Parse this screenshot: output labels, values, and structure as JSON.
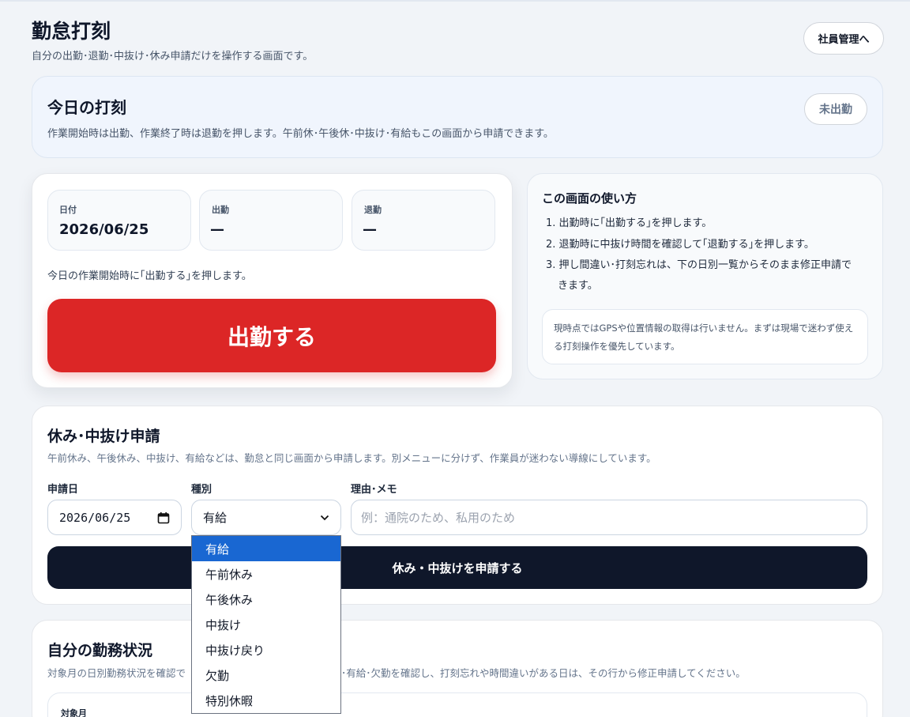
{
  "header": {
    "title": "勤怠打刻",
    "subtitle": "自分の出勤･退勤･中抜け･休み申請だけを操作する画面です。",
    "employee_admin_button": "社員管理へ"
  },
  "today": {
    "title": "今日の打刻",
    "description": "作業開始時は出勤、作業終了時は退勤を押します。午前休･午後休･中抜け･有給もこの画面から申請できます。",
    "status": "未出勤"
  },
  "punch": {
    "date_label": "日付",
    "date_value": "2026/06/25",
    "clock_in_label": "出勤",
    "clock_in_value": "—",
    "clock_out_label": "退勤",
    "clock_out_value": "—",
    "note": "今日の作業開始時に｢出勤する｣を押します。",
    "button_label": "出勤する"
  },
  "howto": {
    "title": "この画面の使い方",
    "steps": [
      "出勤時に｢出勤する｣を押します。",
      "退勤時に中抜け時間を確認して｢退勤する｣を押します。",
      "押し間違い･打刻忘れは、下の日別一覧からそのまま修正申請できます。"
    ],
    "note": "現時点ではGPSや位置情報の取得は行いません。まずは現場で迷わず使える打刻操作を優先しています。"
  },
  "leave": {
    "title": "休み･中抜け申請",
    "description": "午前休み、午後休み、中抜け、有給などは、勤怠と同じ画面から申請します。別メニューに分けず、作業員が迷わない導線にしています。",
    "date_label": "申請日",
    "date_value": "2026/06/25",
    "type_label": "種別",
    "type_value": "有給",
    "memo_label": "理由･メモ",
    "memo_placeholder": "例：通院のため、私用のため",
    "submit_label": "休み・中抜けを申請する",
    "type_options": [
      "有給",
      "午前休み",
      "午後休み",
      "中抜け",
      "中抜け戻り",
      "欠勤",
      "特別休暇"
    ]
  },
  "work_status": {
    "title": "自分の勤務状況",
    "description_left": "対象月の日別勤務状況を確認で",
    "description_right": "･有給･欠勤を確認し、打刻忘れや時間違いがある日は、その行から修正申請してください。",
    "month_label": "対象月"
  }
}
